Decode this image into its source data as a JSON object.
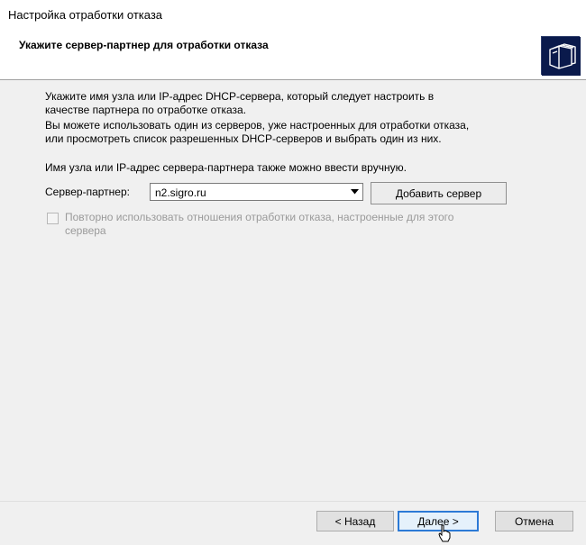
{
  "window": {
    "title": "Настройка отработки отказа"
  },
  "header": {
    "heading": "Укажите сервер-партнер для отработки отказа",
    "icon": "wizard-folders-icon"
  },
  "instructions": {
    "line1": "Укажите имя узла или IP-адрес DHCP-сервера, который следует настроить в качестве партнера по отработке отказа.",
    "line2": "Вы можете использовать один из серверов, уже настроенных для отработки отказа, или просмотреть список разрешенных DHCP-серверов и выбрать один из них.",
    "line3": "Имя узла или IP-адрес сервера-партнера также можно ввести вручную."
  },
  "partner": {
    "label": "Сервер-партнер:",
    "value": "n2.sigro.ru",
    "add_button": "Добавить сервер"
  },
  "reuse": {
    "label": "Повторно использовать отношения отработки отказа, настроенные для этого сервера",
    "checked": false,
    "enabled": false
  },
  "footer": {
    "back": "< Назад",
    "next": "Далее >",
    "cancel": "Отмена"
  },
  "colors": {
    "body_bg": "#f0f0f0",
    "header_bg": "#ffffff",
    "focus_border": "#2c7ad6",
    "icon_bg": "#0a1a4c"
  }
}
